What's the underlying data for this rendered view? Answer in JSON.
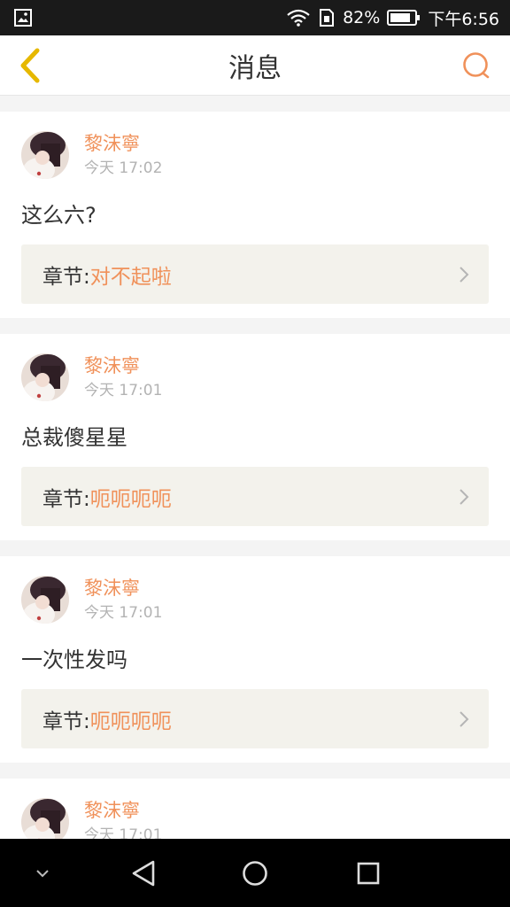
{
  "status_bar": {
    "battery": "82%",
    "time": "下午6:56"
  },
  "header": {
    "title": "消息"
  },
  "messages": [
    {
      "username": "黎沫寧",
      "time": "今天 17:02",
      "content": "这么六?",
      "chapter_label": "章节:",
      "chapter_title": "对不起啦"
    },
    {
      "username": "黎沫寧",
      "time": "今天 17:01",
      "content": "总裁傻星星",
      "chapter_label": "章节:",
      "chapter_title": "呃呃呃呃"
    },
    {
      "username": "黎沫寧",
      "time": "今天 17:01",
      "content": "一次性发吗",
      "chapter_label": "章节:",
      "chapter_title": "呃呃呃呃"
    },
    {
      "username": "黎沫寧",
      "time": "今天 17:01"
    }
  ],
  "colors": {
    "accent": "#f0915a",
    "back_icon": "#e6b800",
    "chapter_bg": "#f3f2ec"
  },
  "icons": {
    "back": "chevron-left-icon",
    "search": "search-icon",
    "chapter_arrow": "chevron-right-icon"
  }
}
